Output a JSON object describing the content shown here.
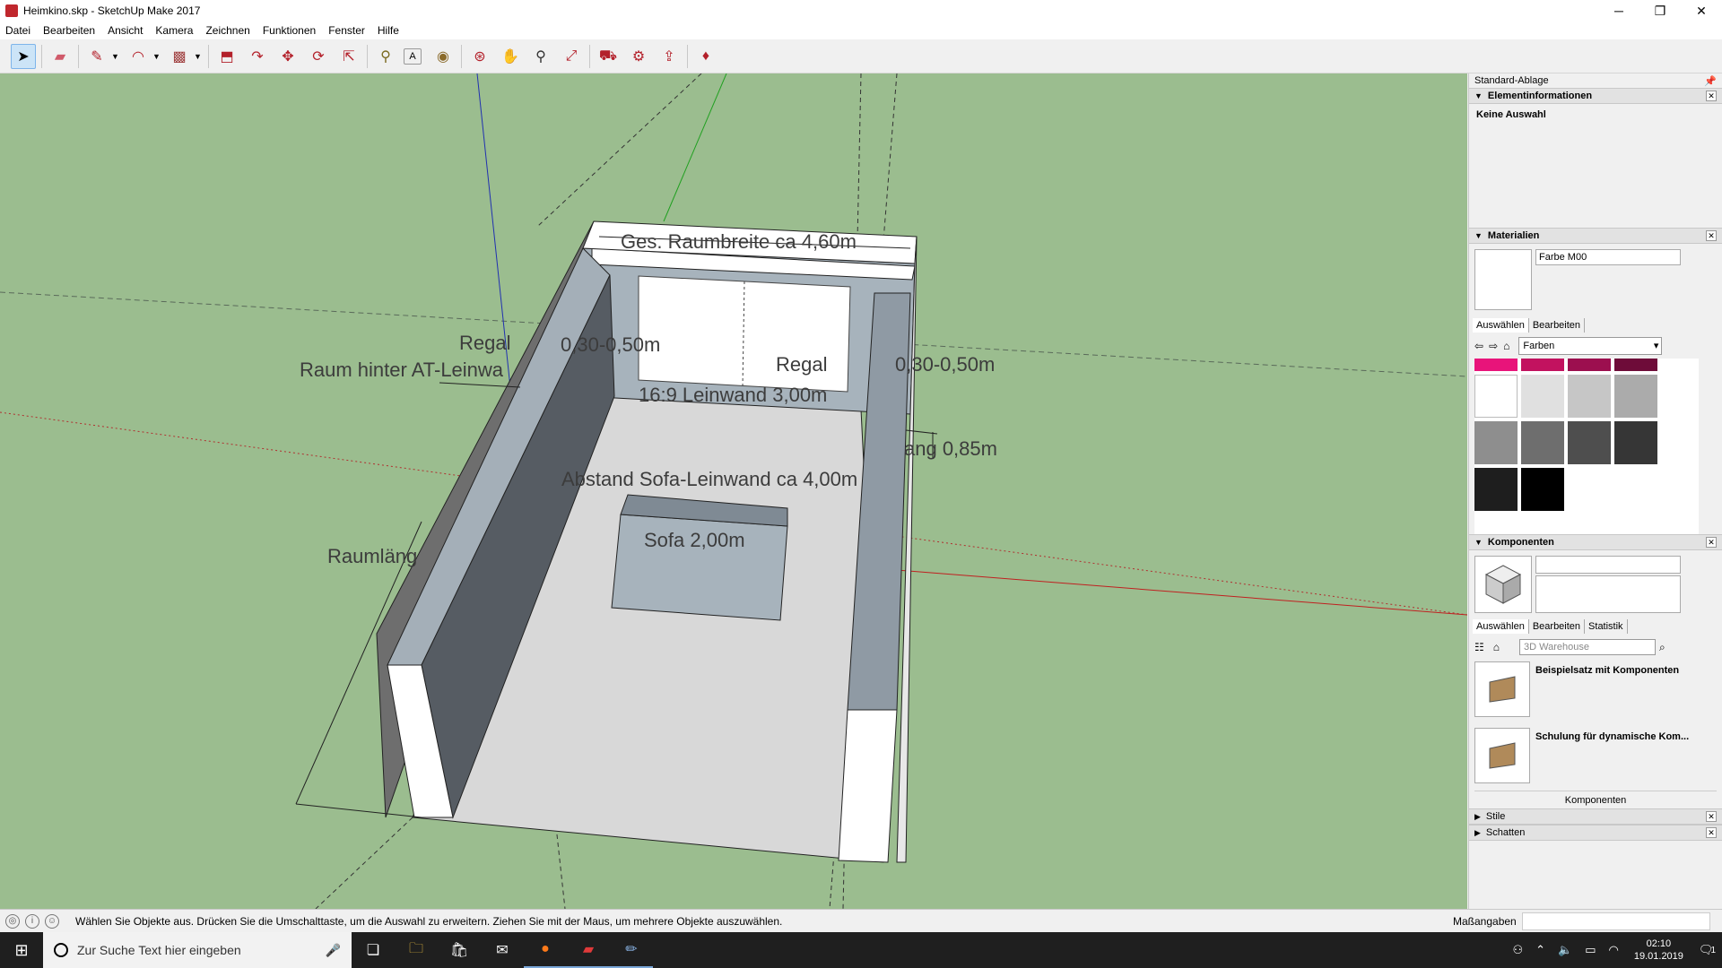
{
  "window": {
    "title": "Heimkino.skp - SketchUp Make 2017",
    "minimize": "─",
    "maximize": "❐",
    "close": "✕"
  },
  "menu": [
    "Datei",
    "Bearbeiten",
    "Ansicht",
    "Kamera",
    "Zeichnen",
    "Funktionen",
    "Fenster",
    "Hilfe"
  ],
  "toolbar": [
    {
      "name": "select-tool",
      "icon": "arrow-icon",
      "glyph": "➤"
    },
    {
      "name": "eraser-tool",
      "icon": "eraser-icon",
      "glyph": "▰"
    },
    {
      "name": "line-tool",
      "icon": "pencil-icon",
      "glyph": "✎"
    },
    {
      "name": "arc-tool",
      "icon": "arc-icon",
      "glyph": "◠"
    },
    {
      "name": "rectangle-tool",
      "icon": "rectangle-icon",
      "glyph": "▩"
    },
    {
      "name": "push-pull-tool",
      "icon": "push-pull-icon",
      "glyph": "⬒"
    },
    {
      "name": "follow-me-tool",
      "icon": "follow-me-icon",
      "glyph": "↷"
    },
    {
      "name": "move-tool",
      "icon": "move-icon",
      "glyph": "✥"
    },
    {
      "name": "rotate-tool",
      "icon": "rotate-icon",
      "glyph": "⟳"
    },
    {
      "name": "scale-tool",
      "icon": "scale-icon",
      "glyph": "⇱"
    },
    {
      "name": "tape-measure-tool",
      "icon": "tape-measure-icon",
      "glyph": "⚲"
    },
    {
      "name": "text-tool",
      "icon": "text-icon",
      "glyph": "A"
    },
    {
      "name": "paint-bucket-tool",
      "icon": "paint-bucket-icon",
      "glyph": "◉"
    },
    {
      "name": "orbit-tool",
      "icon": "orbit-icon",
      "glyph": "⊛"
    },
    {
      "name": "pan-tool",
      "icon": "hand-icon",
      "glyph": "✋"
    },
    {
      "name": "zoom-tool",
      "icon": "zoom-icon",
      "glyph": "⚲"
    },
    {
      "name": "zoom-extents-tool",
      "icon": "zoom-extents-icon",
      "glyph": "⤢"
    },
    {
      "name": "warehouse-button",
      "icon": "warehouse-icon",
      "glyph": "⛟"
    },
    {
      "name": "extension-warehouse-button",
      "icon": "extension-icon",
      "glyph": "⚙"
    },
    {
      "name": "share-model-button",
      "icon": "share-icon",
      "glyph": "⇪"
    },
    {
      "name": "ruby-console-button",
      "icon": "ruby-icon",
      "glyph": "♦"
    }
  ],
  "dimensions": {
    "room_width": "Ges. Raumbreite ca 4,60m",
    "shelf_left_label": "Regal",
    "shelf_left_value": "0,30-0,50m",
    "shelf_right_label": "Regal",
    "shelf_right_value": "0,30-0,50m",
    "behind_screen": "Raum hinter AT-Leinwa",
    "screen": "16:9 Leinwand 3,00m",
    "depth_right": "ang 0,85m",
    "distance": "Abstand Sofa-Leinwand ca 4,00m",
    "sofa": "Sofa 2,00m",
    "room_length": "Raumläng"
  },
  "panel": {
    "title": "Standard-Ablage",
    "entity": {
      "title": "Elementinformationen",
      "value": "Keine Auswahl"
    },
    "materials": {
      "title": "Materialien",
      "name": "Farbe M00",
      "tabs": [
        "Auswählen",
        "Bearbeiten"
      ],
      "library": "Farben",
      "colors": [
        "#e8147a",
        "#c2125f",
        "#9c0f4f",
        "#6e0c39",
        "#ffffff",
        "#e0e0e0",
        "#c6c6c6",
        "#ababab",
        "#8e8e8e",
        "#6e6e6e",
        "#4e4e4e",
        "#363636",
        "#1e1e1e",
        "#000000"
      ]
    },
    "components": {
      "title": "Komponenten",
      "tabs": [
        "Auswählen",
        "Bearbeiten",
        "Statistik"
      ],
      "search_placeholder": "3D Warehouse",
      "items": [
        "Beispielsatz mit Komponenten",
        "Schulung für dynamische Kom..."
      ],
      "footer": "Komponenten"
    },
    "collapsed": [
      "Stile",
      "Schatten"
    ]
  },
  "status": {
    "text": "Wählen Sie Objekte aus. Drücken Sie die Umschalttaste, um die Auswahl zu erweitern. Ziehen Sie mit der Maus, um mehrere Objekte auszuwählen.",
    "measure_label": "Maßangaben"
  },
  "taskbar": {
    "search": "Zur Suche Text hier eingeben",
    "time": "02:10",
    "date": "19.01.2019",
    "notifications": "1"
  }
}
